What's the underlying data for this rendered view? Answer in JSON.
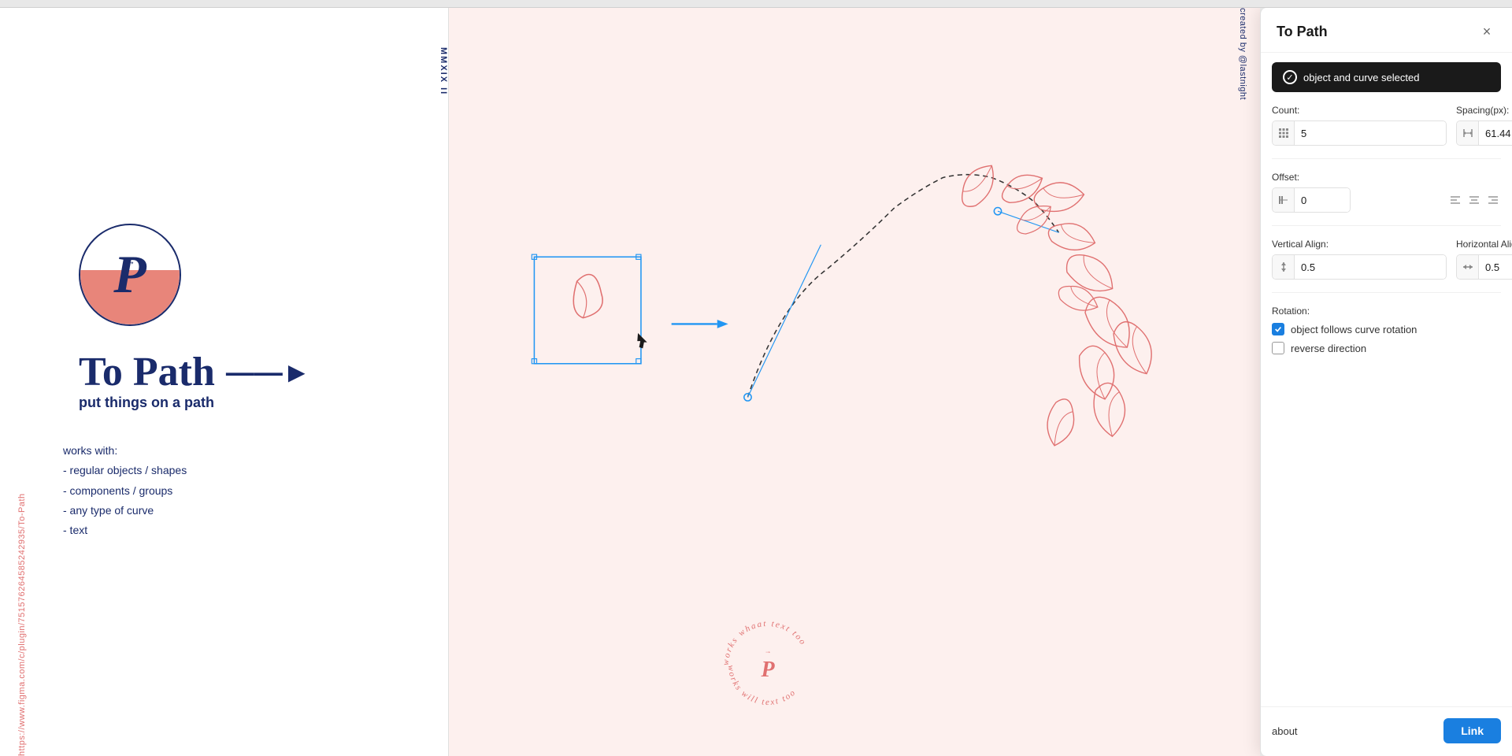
{
  "topBar": {},
  "leftPanel": {
    "url": "https://www.figma.com/c/plugin/751576264585242935/To-Path",
    "logoLetter": "P",
    "title": "To Path",
    "titleArrow": "——►",
    "subtitle": "put things on a path",
    "worksWithTitle": "works with:",
    "worksList": [
      "- regular objects / shapes",
      "- components / groups",
      "- any type of curve",
      "- text"
    ]
  },
  "mmxixLabel": "MMXIX II",
  "createdBy": "created by @lastnight",
  "pluginPanel": {
    "title": "To Path",
    "closeLabel": "×",
    "statusText": "object and curve selected",
    "countLabel": "Count:",
    "countValue": "5",
    "spacingLabel": "Spacing(px):",
    "spacingValue": "61.44",
    "offsetLabel": "Offset:",
    "offsetValue": "0",
    "verticalAlignLabel": "Vertical Align:",
    "verticalAlignValue": "0.5",
    "horizontalAlignLabel": "Horizontal Align",
    "horizontalAlignValue": "0.5",
    "rotationLabel": "Rotation:",
    "checkbox1Label": "object follows curve rotation",
    "checkbox2Label": "reverse direction",
    "aboutText": "about",
    "linkButtonText": "Link"
  }
}
